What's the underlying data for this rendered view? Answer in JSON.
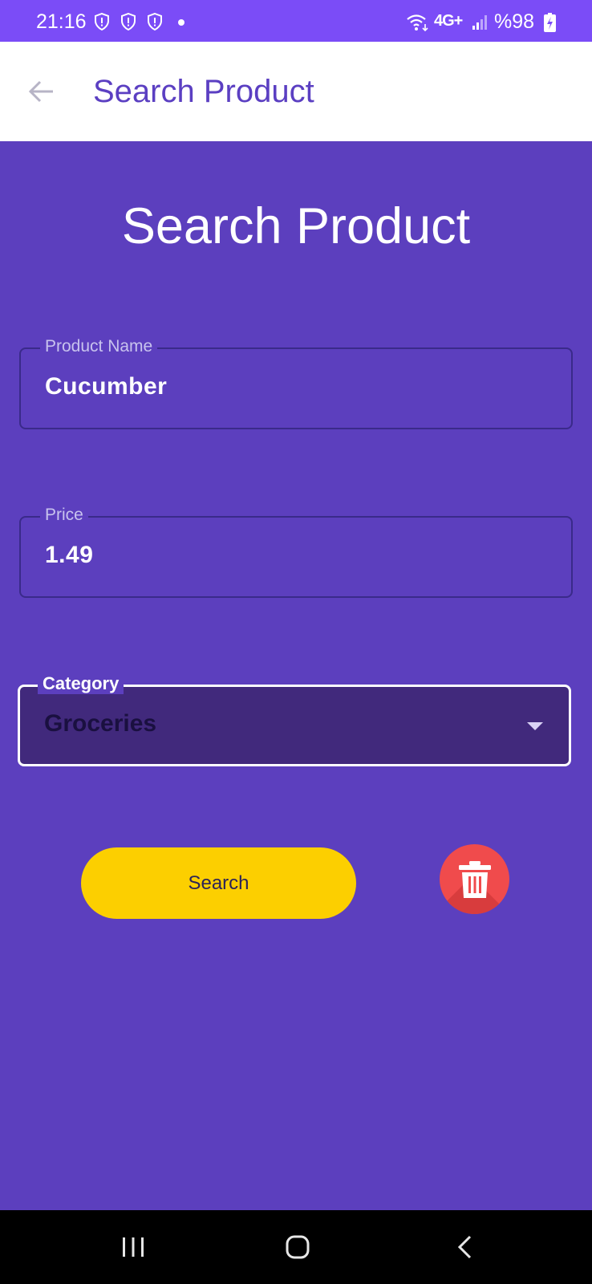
{
  "status_bar": {
    "time": "21:16",
    "battery_text": "%98",
    "network": "4G+",
    "icons": [
      "shield-icon",
      "shield-icon",
      "shield-icon",
      "notification-dot",
      "wifi-icon",
      "signal-icon",
      "battery-charging-icon"
    ]
  },
  "app_bar": {
    "title": "Search Product",
    "back_icon": "arrow-left-icon"
  },
  "main": {
    "title": "Search Product",
    "product_name": {
      "label": "Product Name",
      "value": "Cucumber"
    },
    "price": {
      "label": "Price",
      "value": "1.49"
    },
    "category": {
      "label": "Category",
      "value": "Groceries",
      "icon": "dropdown-arrow-icon"
    },
    "search_button": "Search",
    "delete_icon": "trash-icon"
  },
  "nav_bar": {
    "icons": [
      "recent-apps-icon",
      "home-icon",
      "back-icon"
    ]
  },
  "colors": {
    "status_bar": "#7b4cf7",
    "background": "#5c3fbe",
    "app_bar_title": "#5b3fc2",
    "search_button": "#fccf00",
    "delete_button": "#f04b4c",
    "select_fill": "#41297c"
  }
}
